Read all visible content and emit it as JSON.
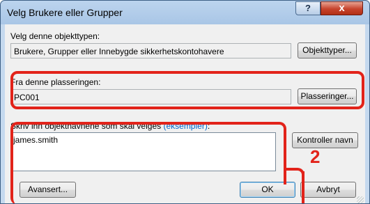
{
  "window": {
    "title": "Velg Brukere eller Grupper",
    "help_label": "?",
    "close_label": "x"
  },
  "object_type": {
    "label": "Velg denne objekttypen:",
    "value": "Brukere, Grupper eller Innebygde sikkerhetskontohavere",
    "button": "Objekttyper..."
  },
  "location": {
    "label": "Fra denne plasseringen:",
    "value": "PC001",
    "button": "Plasseringer..."
  },
  "names": {
    "label": "Skriv inn objektnavnene som skal velges",
    "link": "(eksempler)",
    "label_suffix": ":",
    "value": "james.smith",
    "check_button": "Kontroller navn"
  },
  "footer": {
    "advanced_button": "Avansert...",
    "ok_button": "OK",
    "cancel_button": "Avbryt"
  },
  "annotation": {
    "step_number": "2",
    "highlight_color": "#e2231a"
  }
}
